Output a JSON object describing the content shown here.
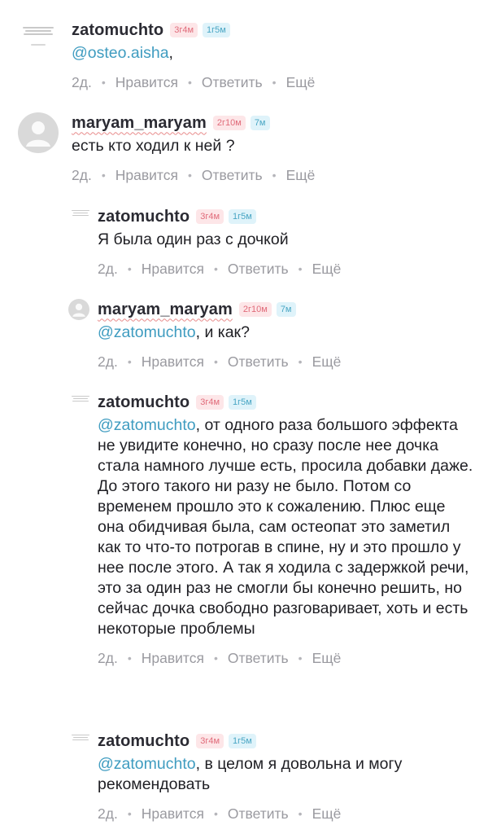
{
  "comments": [
    {
      "username": "zatomuchto",
      "badge1": "3г4м",
      "badge2": "1г5м",
      "mention": "@osteo.aisha",
      "text": ",",
      "time": "2д.",
      "like": "Нравится",
      "reply": "Ответить",
      "more": "Ещё"
    },
    {
      "username": "maryam_maryam",
      "badge1": "2г10м",
      "badge2": "7м",
      "mention": "",
      "text": "есть кто ходил к ней ?",
      "time": "2д.",
      "like": "Нравится",
      "reply": "Ответить",
      "more": "Ещё"
    },
    {
      "username": "zatomuchto",
      "badge1": "3г4м",
      "badge2": "1г5м",
      "mention": "",
      "text": "Я была один раз с дочкой",
      "time": "2д.",
      "like": "Нравится",
      "reply": "Ответить",
      "more": "Ещё"
    },
    {
      "username": "maryam_maryam",
      "badge1": "2г10м",
      "badge2": "7м",
      "mention": "@zatomuchto",
      "text": ", и как?",
      "time": "2д.",
      "like": "Нравится",
      "reply": "Ответить",
      "more": "Ещё"
    },
    {
      "username": "zatomuchto",
      "badge1": "3г4м",
      "badge2": "1г5м",
      "mention": "@zatomuchto",
      "text": ", от одного раза большого эффекта не увидите конечно, но сразу после нее дочка стала намного лучше есть, просила добавки даже. До этого такого ни разу не было. Потом со временем прошло это к сожалению. Плюс еще она обидчивая была, сам остеопат это заметил как то что-то потрогав в спине, ну и это прошло у нее после этого. А так я ходила с задержкой речи, это за один раз не смогли бы конечно решить, но сейчас дочка свободно разговаривает, хоть и есть некоторые проблемы",
      "time": "2д.",
      "like": "Нравится",
      "reply": "Ответить",
      "more": "Ещё"
    },
    {
      "username": "zatomuchto",
      "badge1": "3г4м",
      "badge2": "1г5м",
      "mention": "@zatomuchto",
      "text": ", в целом я довольна и могу рекомендовать",
      "time": "2д.",
      "like": "Нравится",
      "reply": "Ответить",
      "more": "Ещё"
    }
  ],
  "dot": "•",
  "colors": {
    "mention": "#3f9cc0",
    "badge_pink_bg": "#fde6e8",
    "badge_blue_bg": "#dff3fa"
  }
}
